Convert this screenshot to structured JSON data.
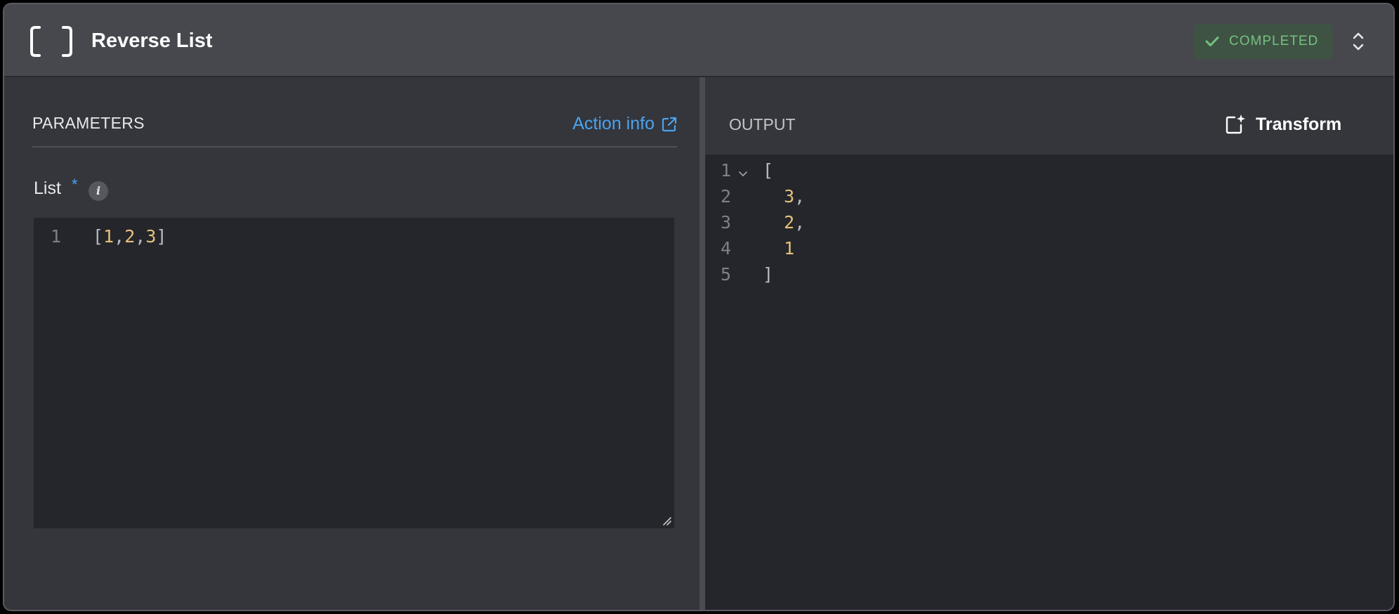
{
  "header": {
    "title": "Reverse List",
    "status": "COMPLETED",
    "icon": "brackets-icon"
  },
  "parameters": {
    "title": "PARAMETERS",
    "action_info": "Action info",
    "field": {
      "label": "List",
      "required_marker": "*",
      "info_glyph": "i",
      "line_number": "1",
      "value_open": "[",
      "value_items": [
        "1",
        "2",
        "3"
      ],
      "value_sep": ",",
      "value_close": "]"
    }
  },
  "output": {
    "title": "OUTPUT",
    "transform_label": "Transform",
    "lines": [
      {
        "no": "1",
        "text": "[",
        "num": "",
        "tail": ""
      },
      {
        "no": "2",
        "text": "  ",
        "num": "3",
        "tail": ","
      },
      {
        "no": "3",
        "text": "  ",
        "num": "2",
        "tail": ","
      },
      {
        "no": "4",
        "text": "  ",
        "num": "1",
        "tail": ""
      },
      {
        "no": "5",
        "text": "]",
        "num": "",
        "tail": ""
      }
    ]
  },
  "colors": {
    "accent_blue": "#4aa3f0",
    "success_green": "#74c27f",
    "number_yellow": "#e5c07b"
  }
}
